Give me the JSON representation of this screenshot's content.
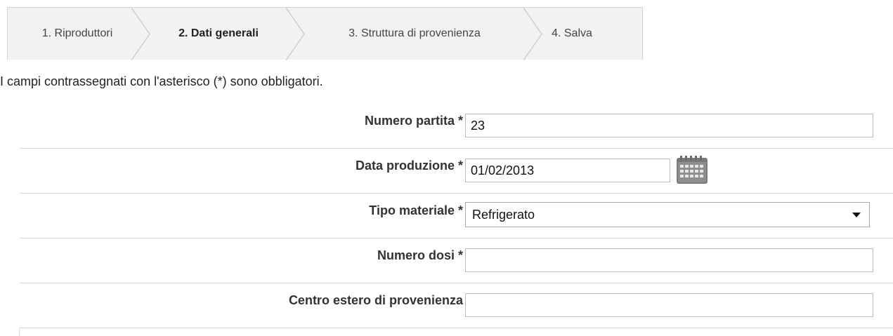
{
  "wizard": {
    "steps": [
      {
        "label": "1. Riproduttori"
      },
      {
        "label": "2. Dati generali"
      },
      {
        "label": "3. Struttura di provenienza"
      },
      {
        "label": "4. Salva"
      }
    ],
    "active_step": 2
  },
  "form": {
    "required_note": "I campi contrassegnati con l'asterisco (*) sono obbligatori.",
    "fields": {
      "numero_partita": {
        "label": "Numero partita *",
        "value": "23"
      },
      "data_produzione": {
        "label": "Data produzione *",
        "value": "01/02/2013",
        "icon": "calendar-icon"
      },
      "tipo_materiale": {
        "label": "Tipo materiale *",
        "selected": "Refrigerato"
      },
      "numero_dosi": {
        "label": "Numero dosi *",
        "value": ""
      },
      "centro_estero": {
        "label": "Centro estero di provenienza",
        "value": ""
      }
    }
  },
  "colors": {
    "tab_background": "#f2f2f2",
    "tab_border": "#d4d4d4",
    "row_divider": "#d8d8d8",
    "calendar_icon": "#7a7a7a"
  }
}
